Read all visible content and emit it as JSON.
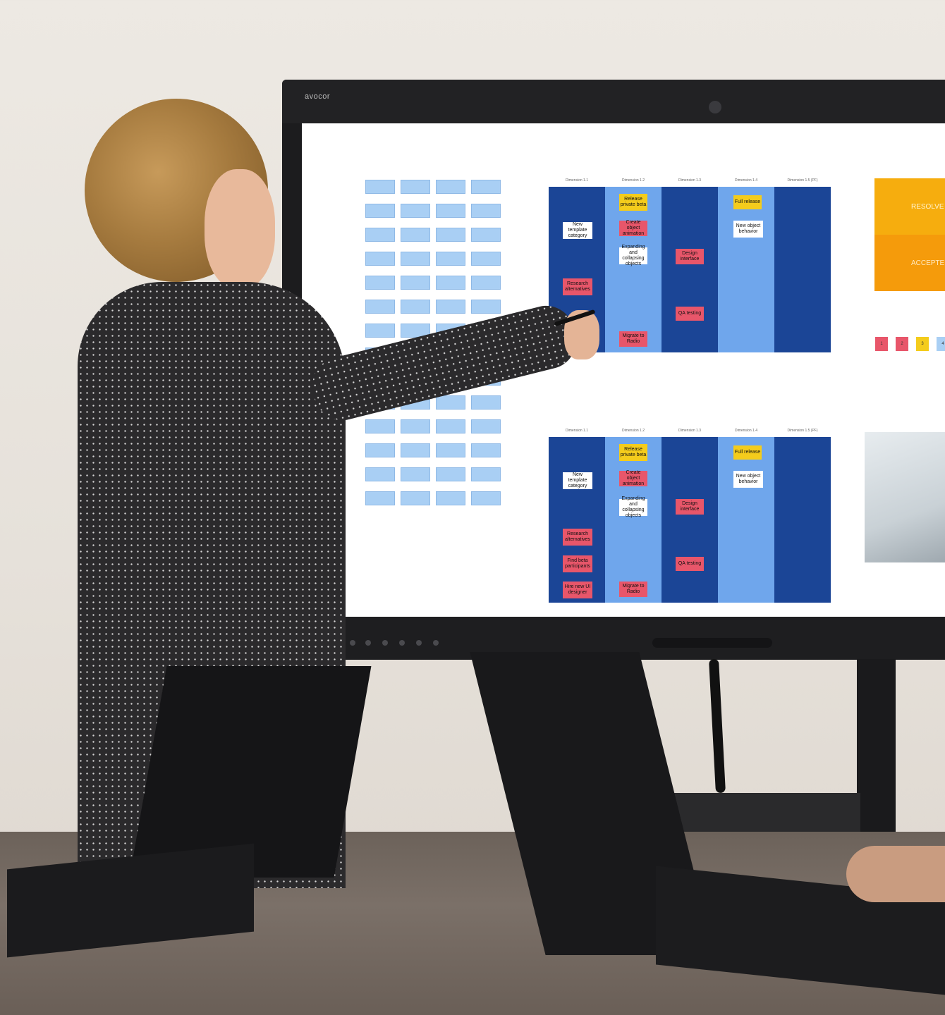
{
  "display": {
    "brand": "avocor"
  },
  "board_top": {
    "headers": [
      "Dimension 1.1",
      "Dimension 1.2",
      "Dimension 1.3",
      "Dimension 1.4",
      "Dimension 1.5 (PF)"
    ],
    "notes": {
      "release_private_beta": "Release private beta",
      "full_release": "Full release",
      "new_template_category": "New template category",
      "create_object_animation": "Create object animation",
      "new_object_behavior": "New object behavior",
      "expanding_collapsing": "Expanding and collapsing objects",
      "design_interface": "Design interface",
      "research_alternatives": "Research alternatives",
      "qa_testing": "QA testing",
      "migrate_to_radio": "Migrate to Radio"
    }
  },
  "board_bottom": {
    "headers": [
      "Dimension 1.1",
      "Dimension 1.2",
      "Dimension 1.3",
      "Dimension 1.4",
      "Dimension 1.5 (PF)"
    ],
    "notes": {
      "release_private_beta": "Release private beta",
      "full_release": "Full release",
      "new_template_category": "New template category",
      "create_object_animation": "Create object animation",
      "new_object_behavior": "New object behavior",
      "expanding_collapsing": "Expanding and collapsing objects",
      "design_interface": "Design interface",
      "research_alternatives": "Research alternatives",
      "find_beta_participants": "Find beta participants",
      "qa_testing": "QA testing",
      "hire_new_ui_designer": "Hire new UI designer",
      "migrate_to_radio": "Migrate to Radio"
    }
  },
  "status_blocks": {
    "resolved": "RESOLVE",
    "accepted": "ACCEPTE"
  },
  "number_tiles": [
    "1",
    "2",
    "3",
    "4"
  ],
  "colors": {
    "board_dark": "#1d4fa3",
    "board_light": "#6fa6ec",
    "pink_note": "#e8566a",
    "yellow_note": "#f4cc1c",
    "sticky_blue": "#a9cff4",
    "resolved_orange": "#f6ad0e"
  }
}
